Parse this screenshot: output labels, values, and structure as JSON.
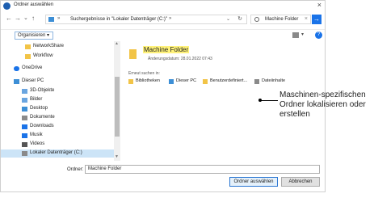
{
  "window": {
    "title": "Ordner auswählen",
    "close_glyph": "×"
  },
  "nav_buttons": {
    "back": "←",
    "forward": "→",
    "dropdown": "⌄",
    "up": "↑"
  },
  "address": {
    "sep1": "»",
    "path": "Suchergebnisse in \"Lokaler Datenträger (C:)\"",
    "sep2": "»",
    "dropdown": "⌄",
    "refresh": "↻"
  },
  "search": {
    "value": "Machine Folder",
    "clear": "×",
    "go": "→"
  },
  "toolbar": {
    "organize": "Organisieren ▾",
    "view_dropdown": "▾",
    "help": "?"
  },
  "navpane": {
    "items": [
      {
        "label": "NetworkShare",
        "icon": "folder-icon",
        "color": "#f2c447"
      },
      {
        "label": "Workflow",
        "icon": "folder-icon",
        "color": "#f2c447"
      },
      {
        "label": "OneDrive",
        "icon": "cloud-icon",
        "color": "#1a73e8"
      },
      {
        "label": "Dieser PC",
        "icon": "pc-icon",
        "color": "#3d8fd6"
      },
      {
        "label": "3D-Objekte",
        "icon": "cube-icon",
        "color": "#6aa5e0"
      },
      {
        "label": "Bilder",
        "icon": "pictures-icon",
        "color": "#6aa5e0"
      },
      {
        "label": "Desktop",
        "icon": "desktop-icon",
        "color": "#3d8fd6"
      },
      {
        "label": "Dokumente",
        "icon": "documents-icon",
        "color": "#8a8a8a"
      },
      {
        "label": "Downloads",
        "icon": "download-icon",
        "color": "#1a73e8"
      },
      {
        "label": "Musik",
        "icon": "music-icon",
        "color": "#1a73e8"
      },
      {
        "label": "Videos",
        "icon": "video-icon",
        "color": "#555555"
      },
      {
        "label": "Lokaler Datenträger (C:)",
        "icon": "drive-icon",
        "color": "#8a8a8a"
      }
    ],
    "scroll_up": "▲",
    "scroll_down": "▼"
  },
  "results": {
    "item": {
      "name": "Machine Folder",
      "date": "Änderungsdatum: 28.01.2022 07:43"
    },
    "search_again_label": "Erneut suchen in:",
    "locations": [
      {
        "label": "Bibliotheken",
        "icon": "library-icon",
        "color": "#f2c447"
      },
      {
        "label": "Dieser PC",
        "icon": "pc-icon",
        "color": "#3d8fd6"
      },
      {
        "label": "Benutzerdefiniert...",
        "icon": "custom-folder-icon",
        "color": "#f2c447"
      },
      {
        "label": "Dateiinhalte",
        "icon": "file-contents-icon",
        "color": "#8a8a8a"
      }
    ]
  },
  "footer": {
    "name_label": "Ordner:",
    "name_value": "Machine Folder",
    "select_button": "Ordner auswählen",
    "cancel_button": "Abbrechen"
  },
  "annotation": {
    "text": "Maschinen-spezifischen Ordner lokalisieren oder erstellen"
  }
}
